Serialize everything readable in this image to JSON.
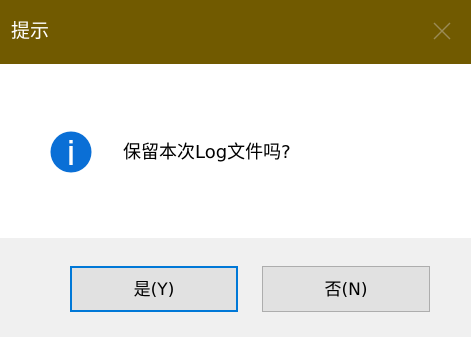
{
  "window": {
    "title": "提示",
    "titlebar_color": "#715a00",
    "close_icon": "close-icon"
  },
  "message": {
    "icon": "info-icon",
    "icon_color": "#0a6fd6",
    "text": "保留本次Log文件吗?"
  },
  "buttons": {
    "yes_label": "是(Y)",
    "no_label": "否(N)",
    "focus_color": "#0078d7"
  }
}
